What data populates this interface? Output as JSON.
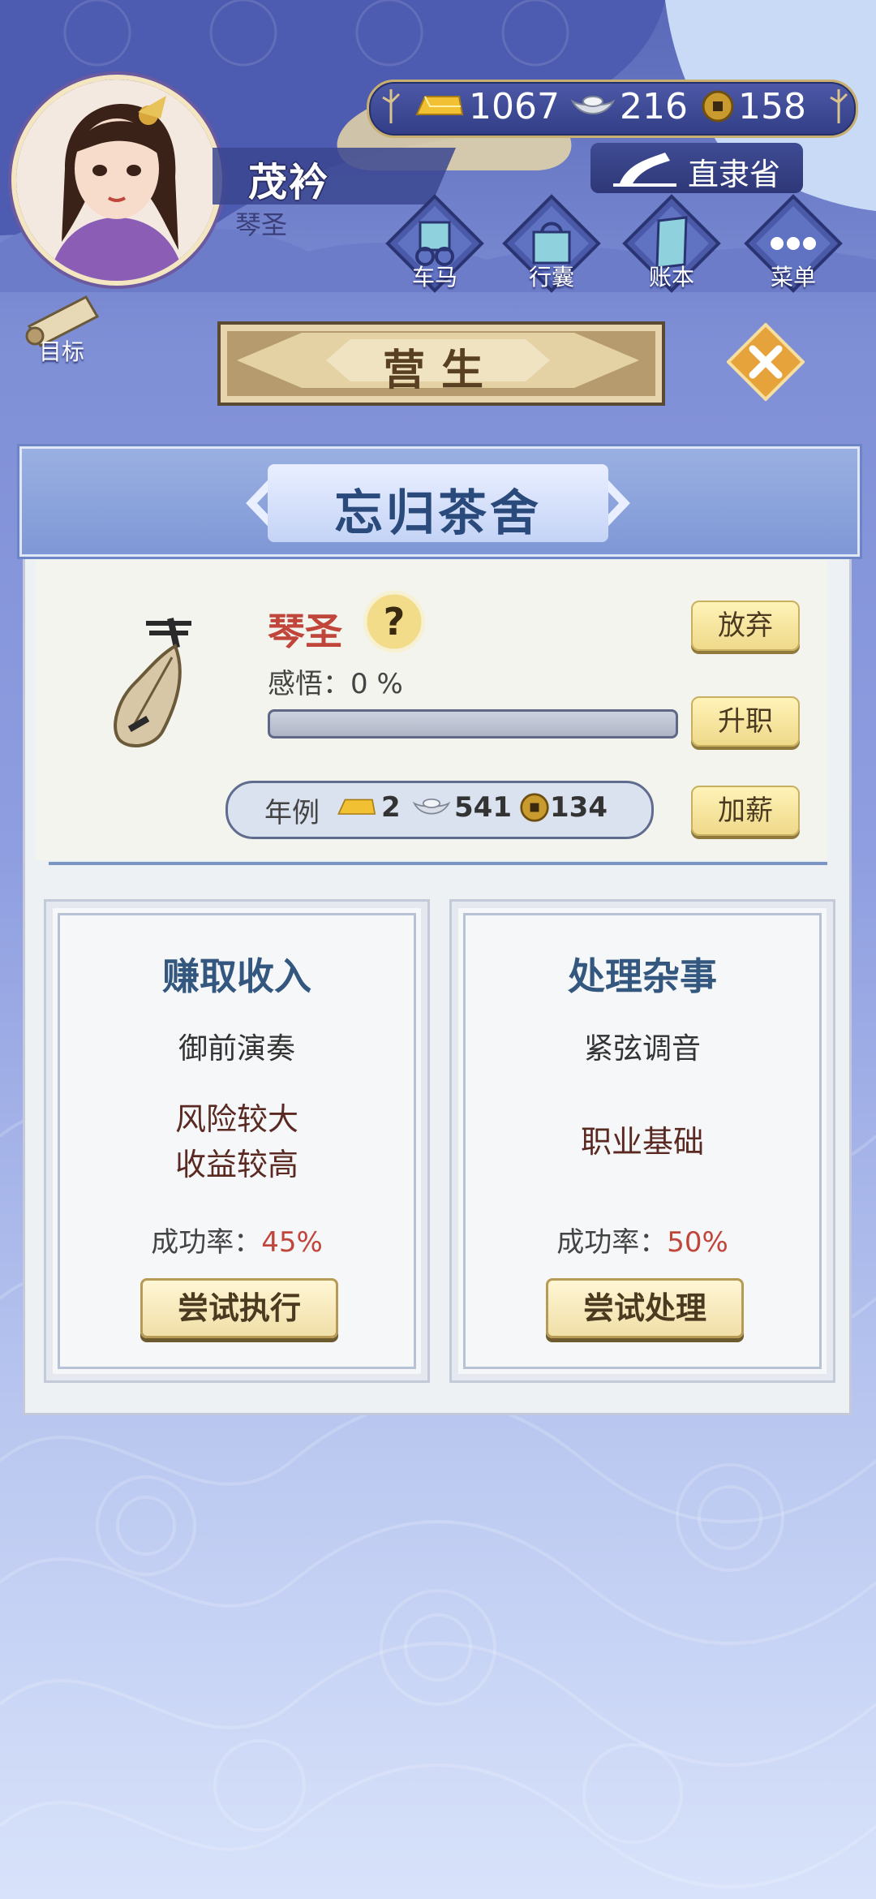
{
  "player": {
    "name": "茂衿",
    "title": "琴圣"
  },
  "currency": {
    "gold": "1067",
    "silver": "216",
    "coin": "158"
  },
  "location": {
    "label": "直隶省"
  },
  "menu": [
    {
      "id": "carriage",
      "label": "车马",
      "icon": "carriage-icon"
    },
    {
      "id": "bag",
      "label": "行囊",
      "icon": "bag-icon"
    },
    {
      "id": "ledger",
      "label": "账本",
      "icon": "ledger-icon"
    },
    {
      "id": "menu",
      "label": "菜单",
      "icon": "more-icon"
    }
  ],
  "goal": {
    "label": "目标"
  },
  "section": {
    "title": "营生"
  },
  "store": {
    "name": "忘归茶舍"
  },
  "job": {
    "title": "琴圣",
    "insight_label": "感悟：",
    "insight_value": "0 %",
    "insight_progress": 0,
    "actions": {
      "abandon": "放弃",
      "promote": "升职",
      "raise": "加薪"
    },
    "salary": {
      "label": "年例",
      "gold": "2",
      "silver": "541",
      "coin": "134"
    }
  },
  "cards": [
    {
      "title": "赚取收入",
      "desc": "御前演奏",
      "note_line1": "风险较大",
      "note_line2": "收益较高",
      "rate_label": "成功率：",
      "rate_value": "45%",
      "button": "尝试执行"
    },
    {
      "title": "处理杂事",
      "desc": "紧弦调音",
      "note_line1": "职业基础",
      "rate_label": "成功率：",
      "rate_value": "50%",
      "button": "尝试处理"
    }
  ],
  "colors": {
    "accent_red": "#c0453a",
    "card_title_blue": "#33577f",
    "button_gold": "#efd98a"
  }
}
